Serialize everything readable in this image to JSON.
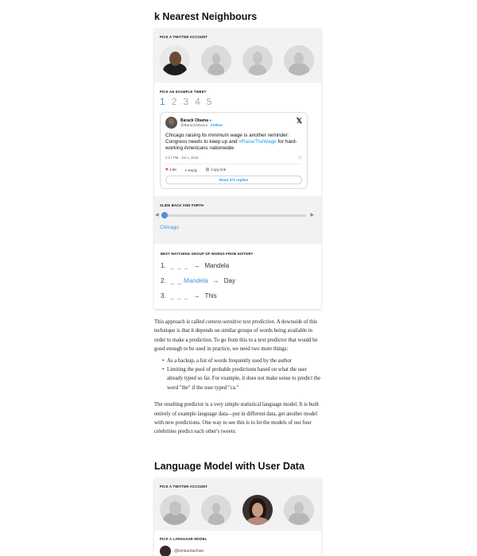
{
  "section1": {
    "title": "k Nearest Neighbours",
    "pick_account_label": "Pick a Twitter account",
    "pick_tweet_label": "Pick an example tweet",
    "tweet_numbers": [
      "1",
      "2",
      "3",
      "4",
      "5"
    ],
    "active_tweet": "1",
    "tweet": {
      "name": "Barack Obama",
      "handle": "@BarackObama",
      "follow": "Follow",
      "text_before": "Chicago raising its minimum wage is another reminder: Congress needs to keep up and ",
      "hashtag": "#RaiseTheWage",
      "text_after": " for hard-working Americans nationwide.",
      "time": "2:17 PM · Jul 1, 2016",
      "info_icon": "ⓘ",
      "likes": "4.6K",
      "reply": "Reply",
      "copy_link": "Copy link",
      "read_replies": "Read 371 replies"
    },
    "slide_label": "Slide back and forth",
    "slide_word": "Chicago",
    "slider_position": 0.0,
    "best_matching_label": "Best matching group of words from history",
    "matches": [
      {
        "num": "1.",
        "blank": "_ _ _",
        "word": "",
        "arrow": "→",
        "result": "Mandela"
      },
      {
        "num": "2.",
        "blank": "_ _",
        "word": "Mandela",
        "arrow": "→",
        "result": "Day"
      },
      {
        "num": "3.",
        "blank": "_ _ _",
        "word": "",
        "arrow": "→",
        "result": "This"
      }
    ]
  },
  "prose": {
    "p1_start": "This approach is called ",
    "p1_em": "context-sensitive text prediction",
    "p1_end": ". A downside of this technique is that it depends on similar groups of words being available in order to make a prediction. To go from this to a text predictor that would be good enough to be used in practice, we need two more things:",
    "bullet1": "As a backup, a list of words frequently used by the author",
    "bullet2": "Limiting the pool of probable predictions based on what the user already typed so far. For example, it does not make sense to predict the word \"the\" if the user typed \"ca.\"",
    "p2": "The resulting predictor is a very simple statistical language model. It is built entirely of example language data—put in different data, get another model with new predictions. One way to see this is to let the models of our four celebrities predict each other's tweets:"
  },
  "section2": {
    "title": "Language Model with User Data",
    "pick_account_label": "Pick a Twitter account",
    "pick_model_label": "Pick a language model",
    "model_handle": "@kimkardashian"
  },
  "colors": {
    "accent": "#4a90e2",
    "twitter_blue": "#1d9bf0",
    "heart": "#e0245e"
  }
}
